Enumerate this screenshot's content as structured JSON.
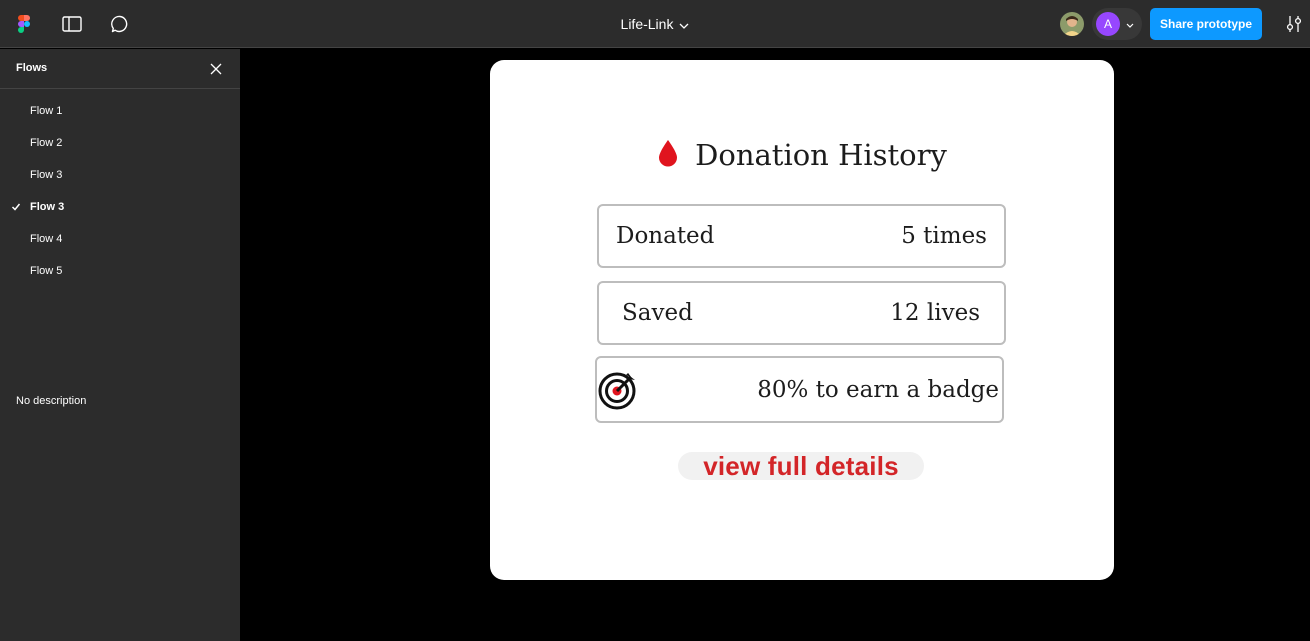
{
  "header": {
    "file_title": "Life-Link",
    "avatar_letter": "A",
    "share_label": "Share prototype",
    "accent_color": "#0d99ff",
    "avatar_color": "#9747ff"
  },
  "sidebar": {
    "title": "Flows",
    "flows": [
      {
        "label": "Flow 1",
        "selected": false
      },
      {
        "label": "Flow 2",
        "selected": false
      },
      {
        "label": "Flow 3",
        "selected": false
      },
      {
        "label": "Flow 3",
        "selected": true
      },
      {
        "label": "Flow 4",
        "selected": false
      },
      {
        "label": "Flow 5",
        "selected": false
      }
    ],
    "description": "No description"
  },
  "prototype": {
    "heading": "Donation History",
    "donated": {
      "label": "Donated",
      "value": "5 times"
    },
    "saved": {
      "label": "Saved",
      "value": "12 lives"
    },
    "badge": {
      "text": "80% to earn a badge",
      "progress_percent": 80
    },
    "details_button": "view full details",
    "brand_red": "#d32528"
  },
  "icons": [
    "figma-logo-icon",
    "panel-toggle-icon",
    "comment-icon",
    "chevron-down-icon",
    "settings-sliders-icon",
    "close-icon",
    "check-icon",
    "blood-drop-icon",
    "target-icon"
  ]
}
